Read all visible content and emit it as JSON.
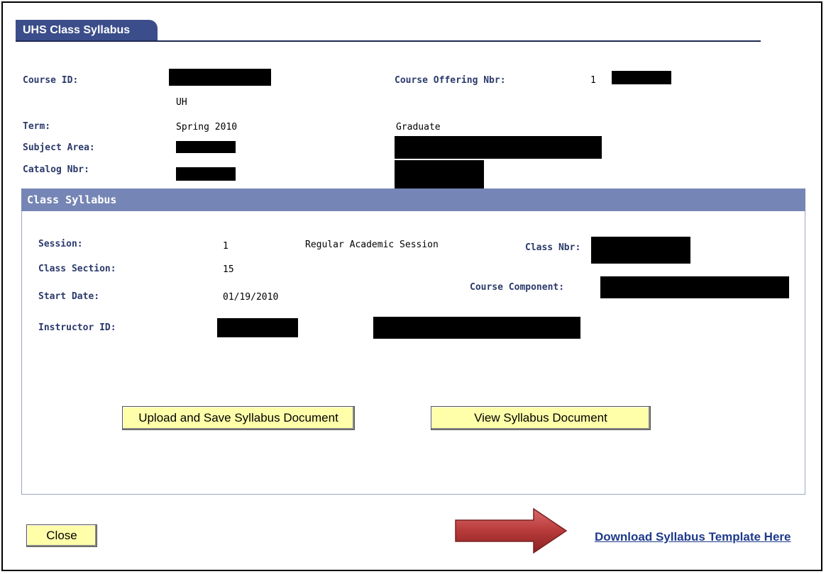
{
  "tab": {
    "title": "UHS Class Syllabus"
  },
  "course": {
    "course_id_label": "Course ID:",
    "institution": "UH",
    "term_label": "Term:",
    "term_value": "Spring 2010",
    "career_value": "Graduate",
    "subject_label": "Subject Area:",
    "catalog_label": "Catalog Nbr:",
    "offering_label": "Course Offering Nbr:",
    "offering_value": "1"
  },
  "class_syllabus": {
    "header": "Class Syllabus",
    "session_label": "Session:",
    "session_value": "1",
    "session_desc": "Regular Academic Session",
    "class_nbr_label": "Class Nbr:",
    "section_label": "Class Section:",
    "section_value": "15",
    "start_label": "Start Date:",
    "start_value": "01/19/2010",
    "component_label": "Course Component:",
    "instructor_label": "Instructor ID:",
    "upload_button": "Upload and Save Syllabus Document",
    "view_button": "View Syllabus Document"
  },
  "footer": {
    "close_button": "Close",
    "download_link": "Download Syllabus Template Here"
  },
  "colors": {
    "tab": "#3b4d8a",
    "group_header": "#7585b5",
    "button": "#ffffaa",
    "label": "#2b3a6b",
    "link": "#1f3a8a",
    "arrow": "#b83a3a"
  },
  "icons": {
    "arrow": "right-arrow-icon"
  }
}
